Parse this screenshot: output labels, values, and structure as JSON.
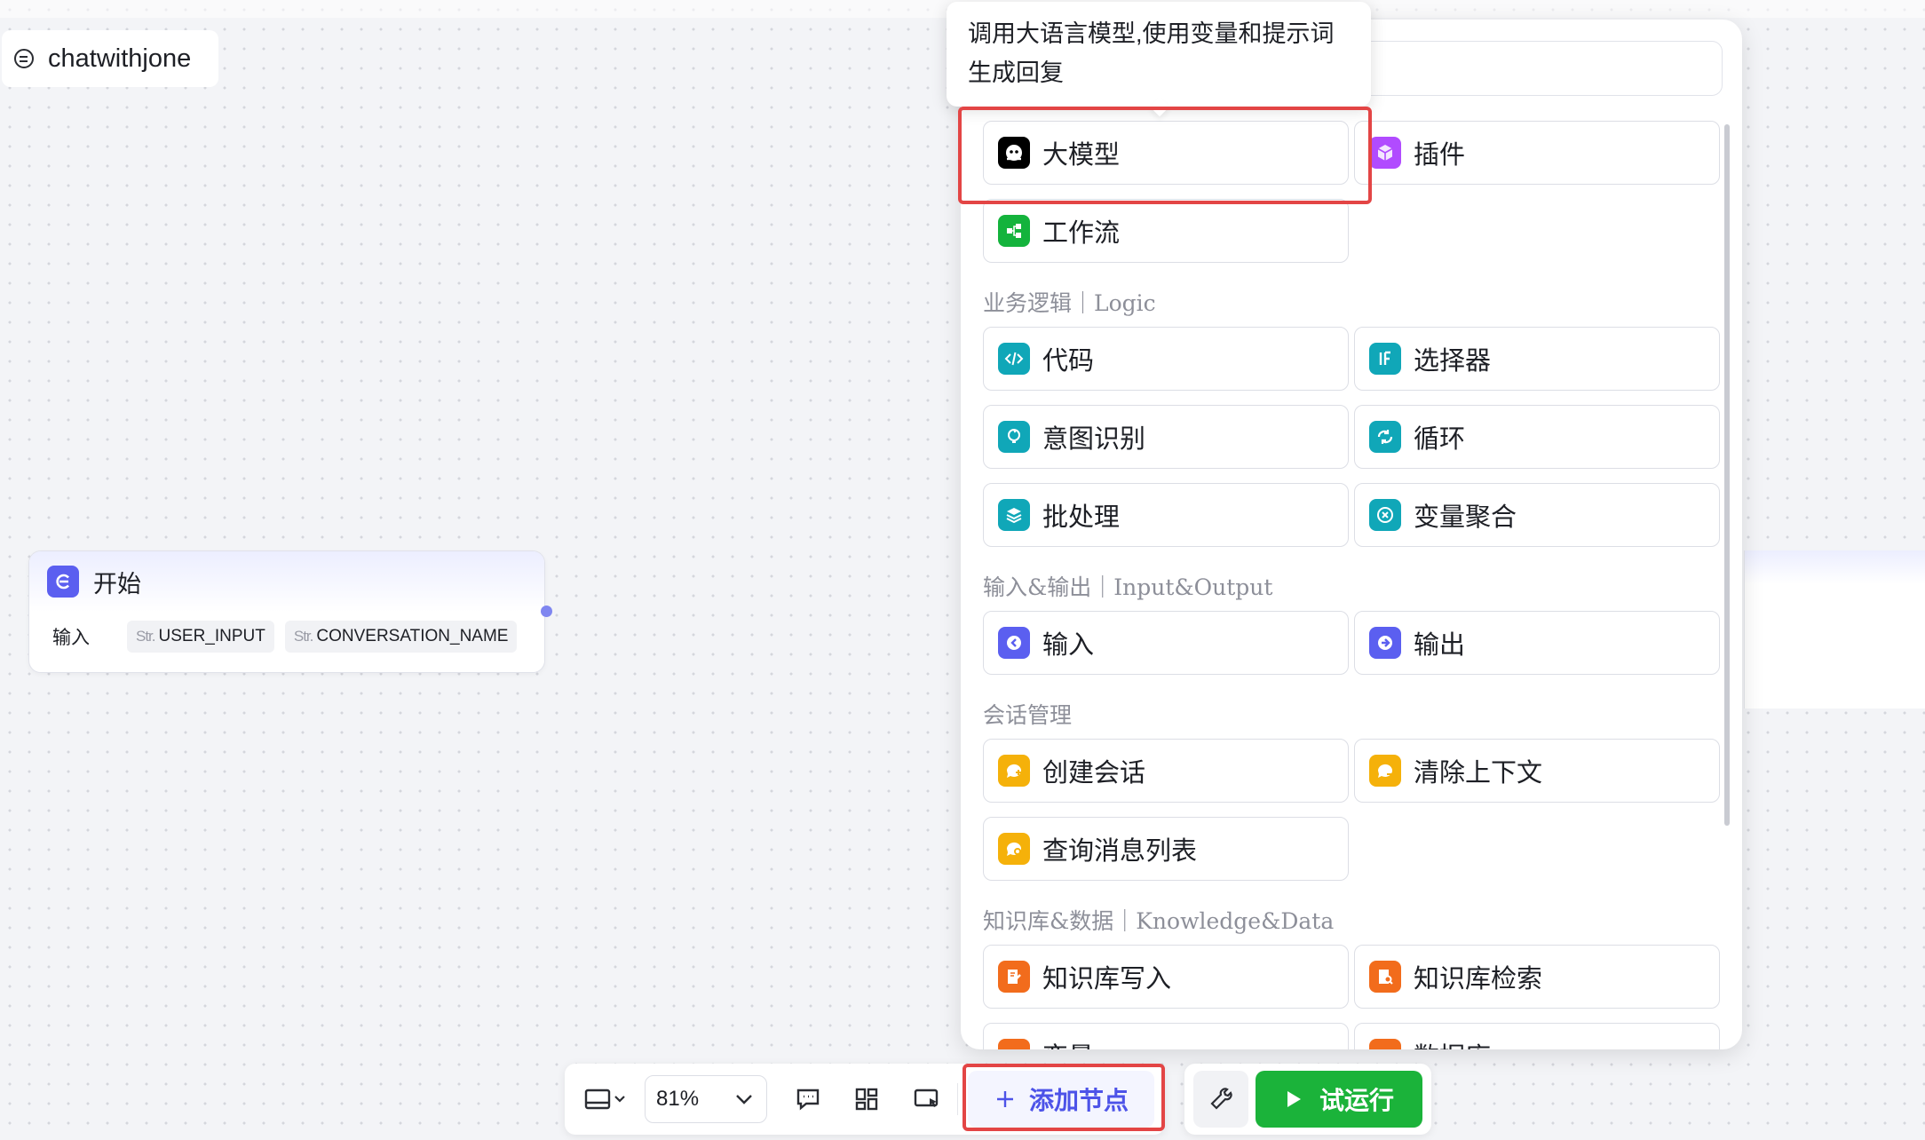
{
  "app": {
    "title": "chatwithjone"
  },
  "start_node": {
    "title": "开始",
    "input_label": "输入",
    "params": [
      {
        "type": "Str.",
        "name": "USER_INPUT"
      },
      {
        "type": "Str.",
        "name": "CONVERSATION_NAME"
      }
    ]
  },
  "tooltip": {
    "text": "调用大语言模型,使用变量和提示词生成回复"
  },
  "node_panel": {
    "top_items": [
      {
        "label": "大模型",
        "icon": "llm-icon",
        "color": "#000000"
      },
      {
        "label": "插件",
        "icon": "plugin-icon",
        "color": "#b14bff"
      },
      {
        "label": "工作流",
        "icon": "workflow-icon",
        "color": "#14b33c"
      }
    ],
    "sections": [
      {
        "title": "业务逻辑｜Logic",
        "items": [
          {
            "label": "代码",
            "icon": "code-icon",
            "color": "#10a7b8"
          },
          {
            "label": "选择器",
            "icon": "if-icon",
            "color": "#10a7b8"
          },
          {
            "label": "意图识别",
            "icon": "intent-icon",
            "color": "#10a7b8"
          },
          {
            "label": "循环",
            "icon": "loop-icon",
            "color": "#10a7b8"
          },
          {
            "label": "批处理",
            "icon": "batch-icon",
            "color": "#10a7b8"
          },
          {
            "label": "变量聚合",
            "icon": "variable-merge-icon",
            "color": "#10a7b8"
          }
        ]
      },
      {
        "title": "输入&输出｜Input&Output",
        "items": [
          {
            "label": "输入",
            "icon": "input-icon",
            "color": "#5b5ff0"
          },
          {
            "label": "输出",
            "icon": "output-icon",
            "color": "#5b5ff0"
          }
        ]
      },
      {
        "title": "会话管理",
        "items": [
          {
            "label": "创建会话",
            "icon": "create-conversation-icon",
            "color": "#f5b10a"
          },
          {
            "label": "清除上下文",
            "icon": "clear-context-icon",
            "color": "#f5b10a"
          },
          {
            "label": "查询消息列表",
            "icon": "query-messages-icon",
            "color": "#f5b10a"
          }
        ]
      },
      {
        "title": "知识库&数据｜Knowledge&Data",
        "items": [
          {
            "label": "知识库写入",
            "icon": "knowledge-write-icon",
            "color": "#f26c1c"
          },
          {
            "label": "知识库检索",
            "icon": "knowledge-search-icon",
            "color": "#f26c1c"
          },
          {
            "label": "变量",
            "icon": "variable-icon",
            "color": "#f26c1c"
          },
          {
            "label": "数据库",
            "icon": "database-icon",
            "color": "#f26c1c"
          }
        ]
      }
    ]
  },
  "toolbar": {
    "zoom": "81%",
    "add_node": "添加节点",
    "run": "试运行"
  },
  "highlight_color": "#e34545"
}
